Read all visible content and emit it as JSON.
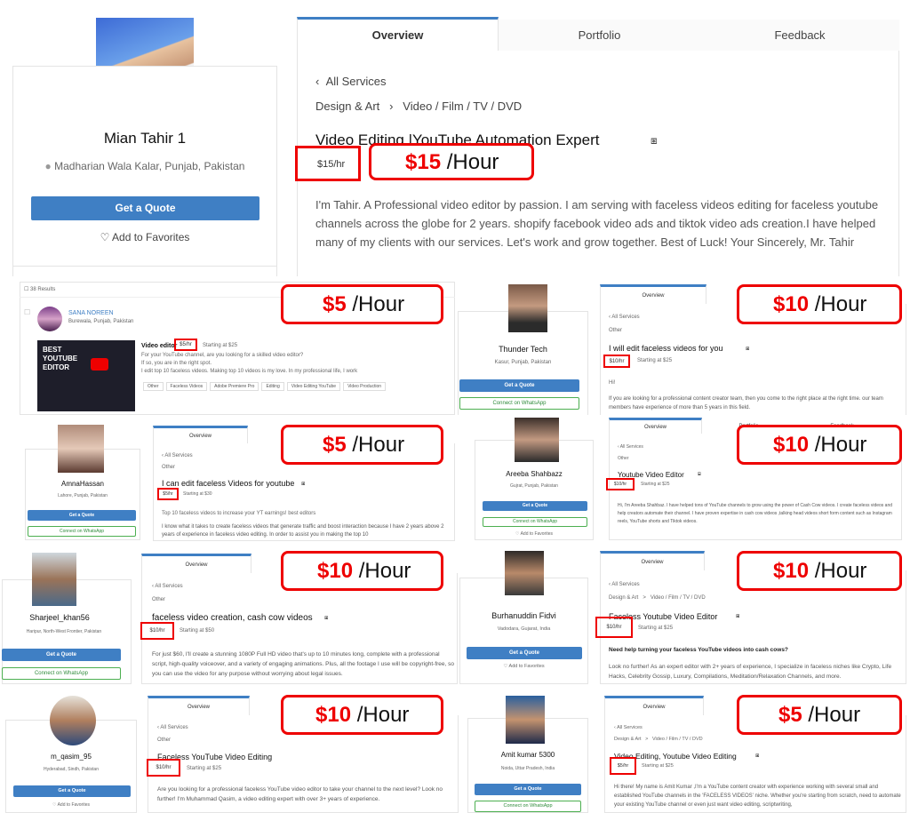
{
  "main": {
    "tabs": [
      "Overview",
      "Portfolio",
      "Feedback"
    ],
    "profile": {
      "name": "Mian Tahir 1",
      "location": "Madharian Wala Kalar, Punjab, Pakistan",
      "quote_btn": "Get a Quote",
      "favorites": "Add to Favorites"
    },
    "back": "All Services",
    "crumb_1": "Design & Art",
    "crumb_2": "Video / Film / TV / DVD",
    "title": "Video Editing |YouTube Automation Expert",
    "price": "$15/hr",
    "callout_amt": "$15",
    "callout_unit": "/Hour",
    "description": "I'm Tahir. A Professional video editor by passion. I am serving with faceless videos editing for faceless youtube channels across the globe for 2 years. shopify facebook video ads and tiktok video ads creation.I have helped many of my clients with our services. Let's work and grow together. Best of Luck! Your Sincerely, Mr. Tahir"
  },
  "c1": {
    "results": "38 Results",
    "name": "SANA NOREEN",
    "location": "Burewala, Punjab, Pakistan",
    "thumb_text": "BEST YOUTUBE EDITOR",
    "title": "Video editor",
    "price": "$5/hr",
    "starting": "Starting at $25",
    "desc_1": "For your YouTube channel, are you looking for a skilled video editor?",
    "desc_2": "If so, you are in the right spot.",
    "desc_3": "I edit top 10 faceless videos. Making top 10 videos is my love. In my professional life, I work",
    "tags": [
      "Other",
      "Faceless Videos",
      "Adobe Premiere Pro",
      "Editing",
      "Video Editing YouTube",
      "Video Production"
    ],
    "callout_amt": "$5",
    "callout_unit": "/Hour"
  },
  "c2": {
    "name": "Thunder Tech",
    "location": "Kasur, Punjab, Pakistan",
    "quote_btn": "Get a Quote",
    "wa_btn": "Connect on WhatsApp",
    "tab": "Overview",
    "back": "All Services",
    "cat": "Other",
    "title": "I will edit faceless videos for you",
    "price": "$10/hr",
    "starting": "Starting at $25",
    "greeting": "Hi!",
    "desc": "If you are looking for a professional content creator team, then you come to the right place at the right time. our team members have experience of more than 5 years in this field.",
    "callout_amt": "$10",
    "callout_unit": "/Hour"
  },
  "c3": {
    "name": "AmnaHassan",
    "location": "Lahore, Punjab, Pakistan",
    "quote_btn": "Get a Quote",
    "wa_btn": "Connect on WhatsApp",
    "tab": "Overview",
    "back": "All Services",
    "cat": "Other",
    "title": "I can edit faceless Videos for youtube",
    "price": "$5/hr",
    "starting": "Starting at $30",
    "desc_1": "Top 10 faceless videos to increase your YT earnings!  best editors",
    "desc_2": "I know what it takes to create faceless videos that generate traffic and boost interaction because I have 2 years above 2 years of experience in faceless video editing. In order to assist you in making the top 10",
    "callout_amt": "$5",
    "callout_unit": "/Hour"
  },
  "c4": {
    "name": "Areeba Shahbazz",
    "location": "Gujrat, Punjab, Pakistan",
    "quote_btn": "Get a Quote",
    "wa_btn": "Connect on WhatsApp",
    "favorites": "Add to Favorites",
    "tabs": [
      "Overview",
      "Portfolio",
      "Feedback"
    ],
    "back": "All Services",
    "cat": "Other",
    "title": "Youtube Video Editor",
    "price": "$10/hr",
    "starting": "Starting at $25",
    "desc": "Hi, I'm Areeba Shahbaz. I have helped tons of YouTube channels to grow using the power of Cash Cow videos. I create faceless videos and help creators automate their channel. I have proven expertise in cash cow videos ,talking head videos short form content such as Instagram reels, YouTube shorts and Tiktok videos.",
    "callout_amt": "$10",
    "callout_unit": "/Hour"
  },
  "c5": {
    "name": "Sharjeel_khan56",
    "location": "Haripur, North-West Frontier, Pakistan",
    "quote_btn": "Get a Quote",
    "wa_btn": "Connect on WhatsApp",
    "tab": "Overview",
    "back": "All Services",
    "cat": "Other",
    "title": "faceless video creation, cash cow videos",
    "price": "$10/hr",
    "starting": "Starting at $50",
    "desc": "For just $60, I'll create a stunning 1080P Full HD video that's up to 10 minutes long, complete with a professional script, high-quality voiceover, and a variety of engaging animations. Plus, all the footage I use will be copyright-free, so you can use the video for any purpose without worrying about legal issues.",
    "callout_amt": "$10",
    "callout_unit": "/Hour"
  },
  "c6": {
    "name": "Burhanuddin Fidvi",
    "location": "Vadodara, Gujarat, India",
    "quote_btn": "Get a Quote",
    "favorites": "Add to Favorites",
    "tab": "Overview",
    "back": "All Services",
    "crumb": "Design & Art   >   Video / Film / TV / DVD",
    "title": "Faceless Youtube Video Editor",
    "price": "$10/hr",
    "starting": "Starting at $25",
    "lead": "Need help turning your faceless YouTube videos into cash cows?",
    "desc": "Look no further! As an expert editor with 2+ years of experience, I specialize in faceless niches like Crypto, Life Hacks, Celebrity Gossip, Luxury, Compilations, Meditation/Relaxation Channels, and more.",
    "callout_amt": "$10",
    "callout_unit": "/Hour"
  },
  "c7": {
    "name": "m_qasim_95",
    "location": "Hyderabad, Sindh, Pakistan",
    "quote_btn": "Get a Quote",
    "favorites": "Add to Favorites",
    "tab": "Overview",
    "back": "All Services",
    "cat": "Other",
    "title": "Faceless YouTube Video Editing",
    "price": "$10/hr",
    "starting": "Starting at $25",
    "desc": "Are you looking for a professional faceless YouTube video editor to take your channel to the next level? Look no further! I'm Muhammad Qasim, a video editing expert with over 3+ years of experience.",
    "callout_amt": "$10",
    "callout_unit": "/Hour"
  },
  "c8": {
    "name": "Amit kumar 5300",
    "location": "Noida, Uttar Pradesh, India",
    "quote_btn": "Get a Quote",
    "wa_btn": "Connect on WhatsApp",
    "tab": "Overview",
    "back": "All Services",
    "crumb": "Design & Art   >   Video / Film / TV / DVD",
    "title": "Video Editing, Youtube Video Editing",
    "price": "$5/hr",
    "starting": "Starting at $25",
    "desc": "Hi there! My name is Amit Kumar ,I'm a YouTube content creator with experience working with several small and established YouTube channels in the 'FACELESS VIDEOS' niche. Whether you're starting from scratch, need to automate your existing YouTube channel or even just want video editing, scriptwriting,",
    "callout_amt": "$5",
    "callout_unit": "/Hour"
  },
  "colors": {
    "accent": "#3f7fc4",
    "highlight": "#e00000",
    "whatsapp": "#4caf50"
  }
}
